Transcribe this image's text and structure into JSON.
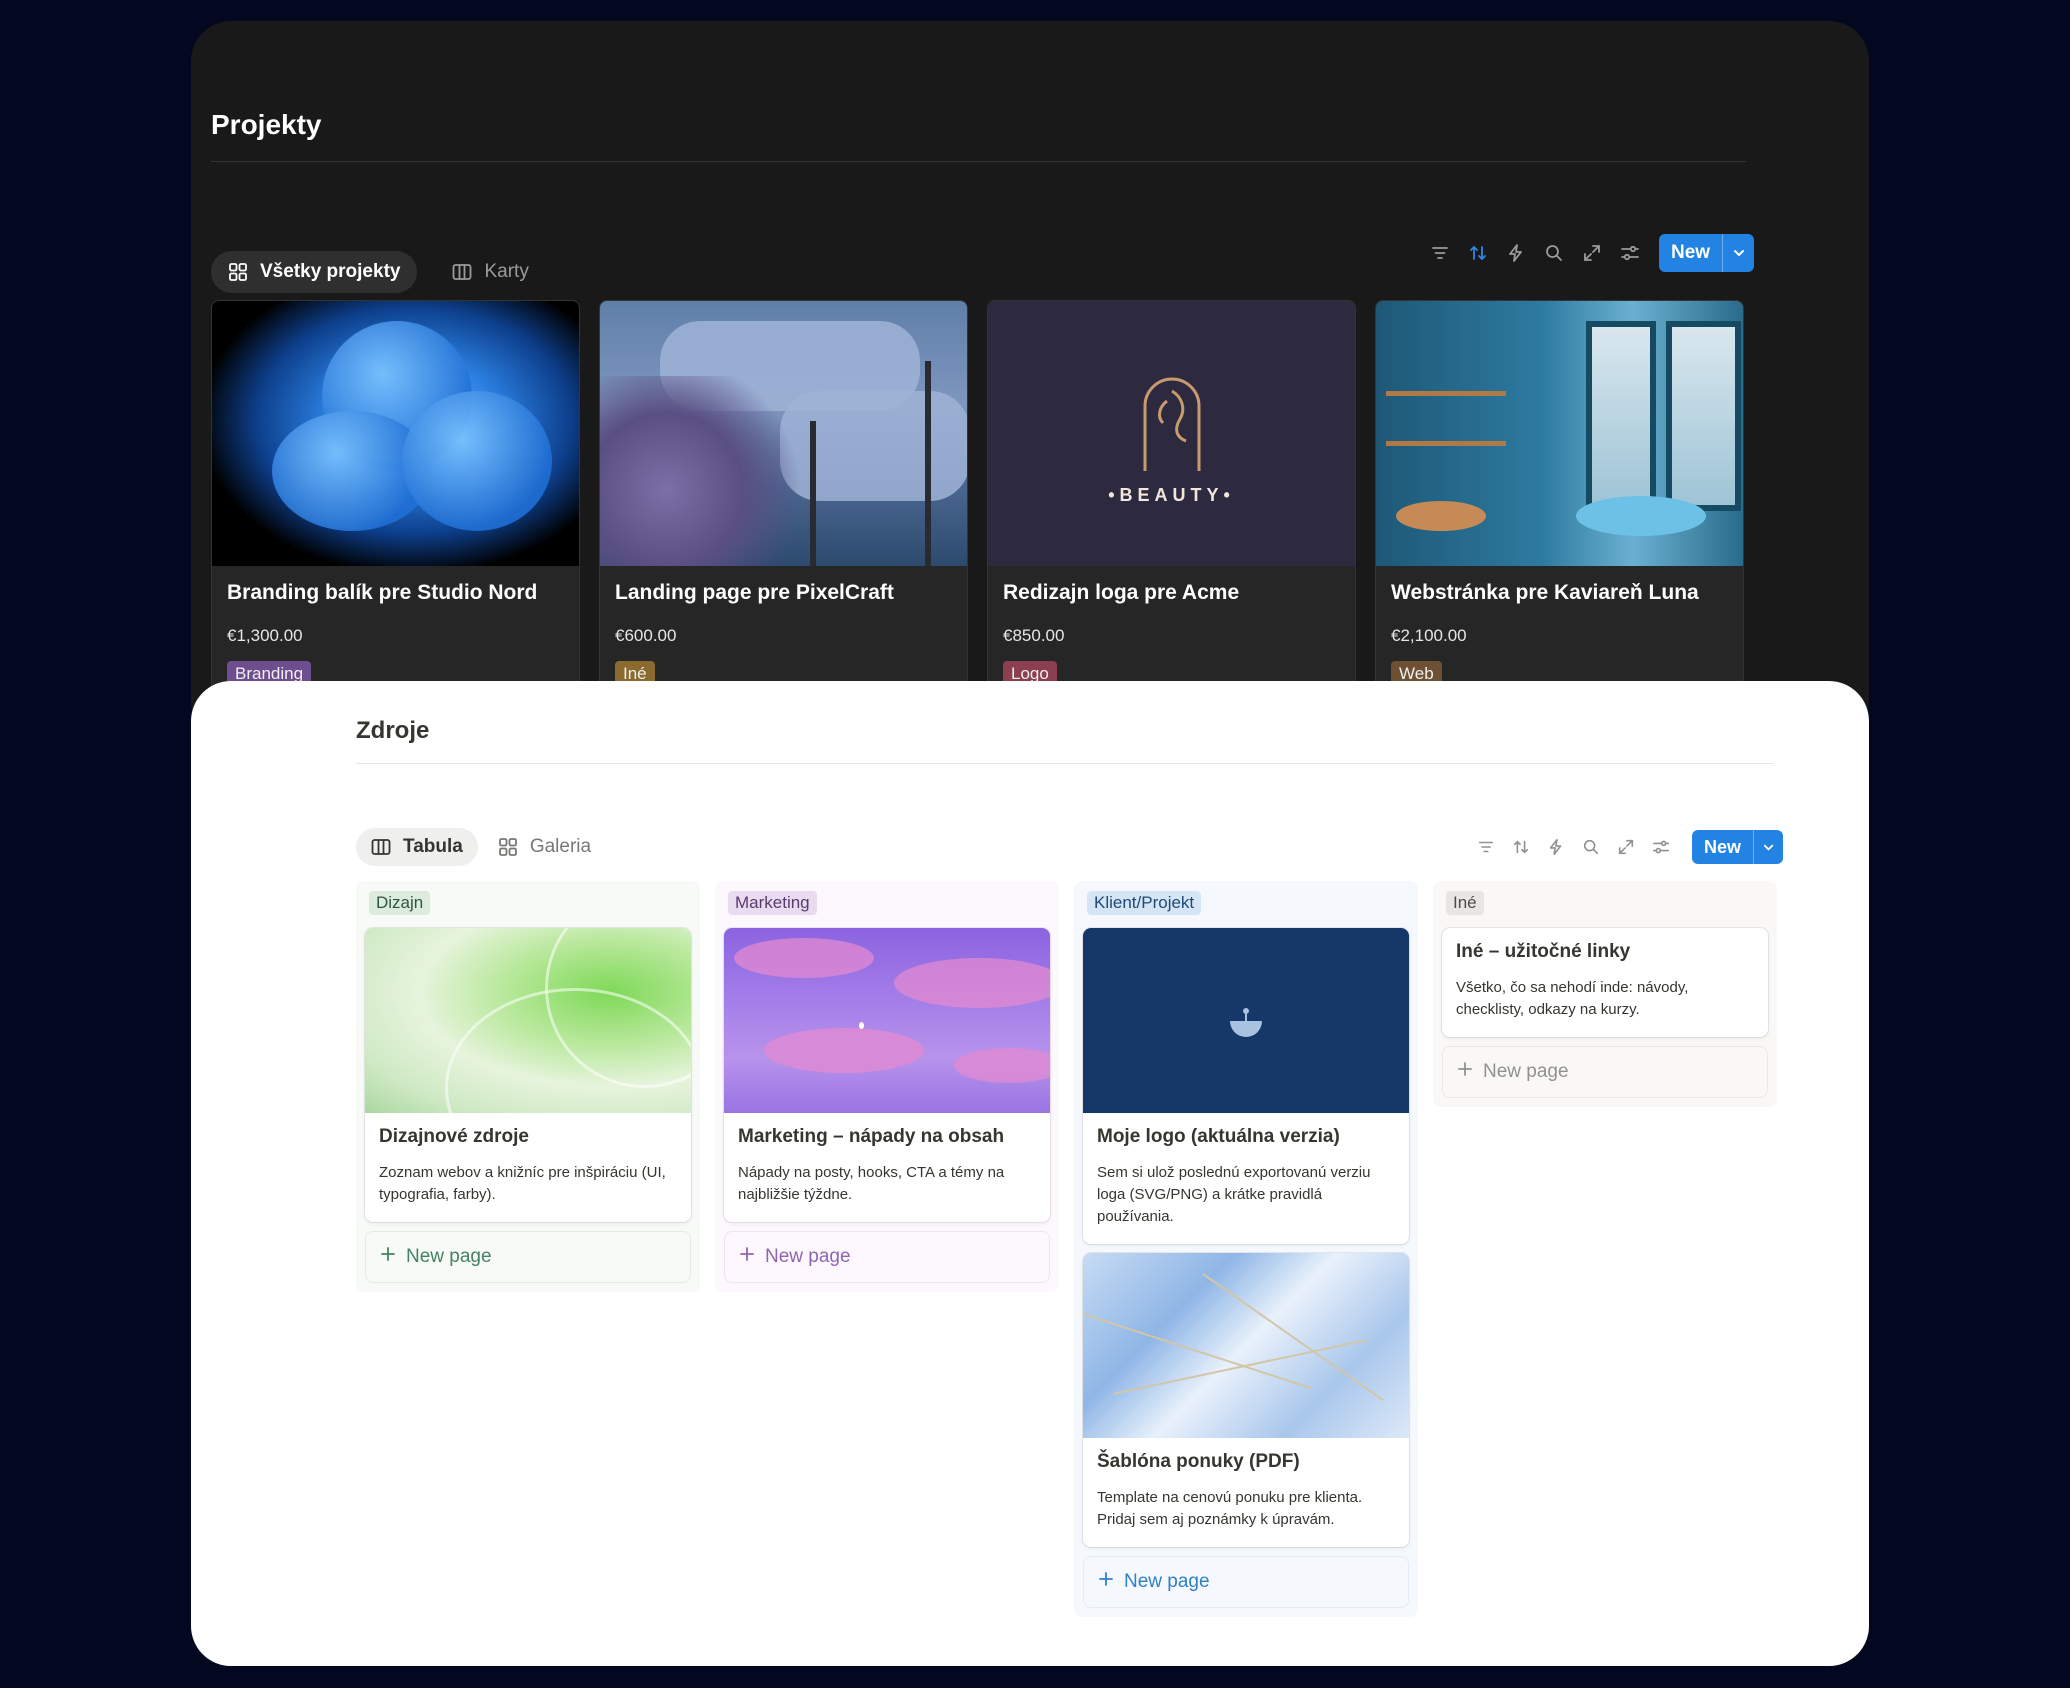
{
  "projects": {
    "title": "Projekty",
    "tabs": [
      {
        "label": "Všetky projekty",
        "icon": "gallery-grid-icon"
      },
      {
        "label": "Karty",
        "icon": "board-columns-icon"
      }
    ],
    "toolbar": {
      "icons": [
        "filter-icon",
        "sort-icon",
        "automation-bolt-icon",
        "search-icon",
        "expand-icon",
        "settings-sliders-icon"
      ],
      "new_label": "New"
    },
    "cards": [
      {
        "title": "Branding balík pre Studio Nord",
        "price": "€1,300.00",
        "tag": "Branding",
        "tag_color": "#6d4f8f",
        "cover": "blue-rose-photo"
      },
      {
        "title": "Landing page pre PixelCraft",
        "price": "€600.00",
        "tag": "Iné",
        "tag_color": "#8a6a2e",
        "cover": "pixel-art-sky"
      },
      {
        "title": "Redizajn loga pre Acme",
        "price": "€850.00",
        "tag": "Logo",
        "tag_color": "#8c3f4f",
        "cover": "beauty-logo",
        "logo_text": "•BEAUTY•"
      },
      {
        "title": "Webstránka pre Kaviareň Luna",
        "price": "€2,100.00",
        "tag": "Web",
        "tag_color": "#6e5035",
        "cover": "cafe-interior-photo"
      }
    ]
  },
  "resources": {
    "title": "Zdroje",
    "tabs": [
      {
        "label": "Tabula",
        "icon": "board-columns-icon"
      },
      {
        "label": "Galeria",
        "icon": "gallery-grid-icon"
      }
    ],
    "toolbar": {
      "icons": [
        "filter-icon",
        "sort-icon",
        "automation-bolt-icon",
        "search-icon",
        "expand-icon",
        "settings-sliders-icon"
      ],
      "new_label": "New"
    },
    "columns": [
      {
        "label": "Dizajn",
        "colors": {
          "bg": "#f7faf7",
          "label_bg": "#dcebdd",
          "label_text": "#2b593f",
          "new_text": "#448361"
        },
        "cards": [
          {
            "title": "Dizajnové zdroje",
            "desc": "Zoznam webov a knižníc pre inšpiráciu (UI, typografia, farby).",
            "cover": "green-abstract"
          }
        ],
        "new_page": "New page"
      },
      {
        "label": "Marketing",
        "colors": {
          "bg": "#fcf8fd",
          "label_bg": "#eadcf0",
          "label_text": "#593a6e",
          "new_text": "#9065b0"
        },
        "cards": [
          {
            "title": "Marketing – nápady na obsah",
            "desc": "Nápady na posty, hooks, CTA a témy na najbližšie týždne.",
            "cover": "purple-sky"
          }
        ],
        "new_page": "New page"
      },
      {
        "label": "Klient/Projekt",
        "colors": {
          "bg": "#f5f9fd",
          "label_bg": "#d5e5f6",
          "label_text": "#1f4a75",
          "new_text": "#2f7fc9"
        },
        "cards": [
          {
            "title": "Moje logo (aktuálna verzia)",
            "desc": "Sem si ulož poslednú exportovanú verziu loga (SVG/PNG) a krátke pravidlá používania.",
            "cover": "navy-moon"
          },
          {
            "title": "Šablóna ponuky (PDF)",
            "desc": "Template na cenovú ponuku pre klienta. Pridaj sem aj poznámky k úpravám.",
            "cover": "blue-marble"
          }
        ],
        "new_page": "New page"
      },
      {
        "label": "Iné",
        "colors": {
          "bg": "#f9f8f7",
          "label_bg": "#e8e6e3",
          "label_text": "#4f4c47",
          "new_text": "#91918e"
        },
        "cards": [
          {
            "title": "Iné – užitočné linky",
            "desc": "Všetko, čo sa nehodí inde: návody, checklisty, odkazy na kurzy.",
            "cover": ""
          }
        ],
        "new_page": "New page"
      }
    ]
  }
}
